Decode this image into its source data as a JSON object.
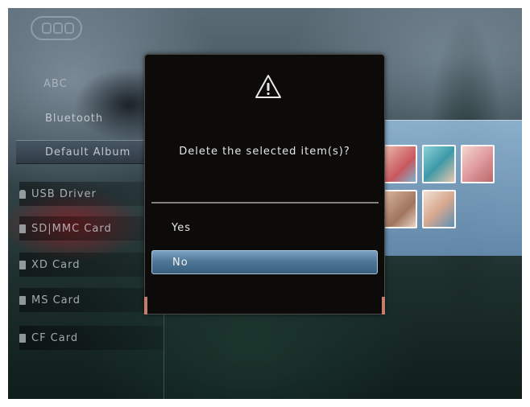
{
  "background": {
    "overlay_label": "ABC"
  },
  "sidebar": {
    "items": [
      {
        "label": "Bluetooth"
      },
      {
        "label": "Default Album"
      },
      {
        "label": "USB Driver"
      },
      {
        "label": "SD|MMC Card"
      },
      {
        "label": "XD Card"
      },
      {
        "label": "MS Card"
      },
      {
        "label": "CF Card"
      }
    ]
  },
  "dialog": {
    "icon": "warning-icon",
    "message": "Delete the selected item(s)?",
    "options": [
      {
        "label": "Yes",
        "selected": false
      },
      {
        "label": "No",
        "selected": true
      }
    ]
  },
  "colors": {
    "dialog_bg": "#0c0b0a",
    "selection": "#4f7796",
    "selection_border": "#a9c6dc",
    "text": "#e6e6e6",
    "warning": "#e8e8e8"
  }
}
